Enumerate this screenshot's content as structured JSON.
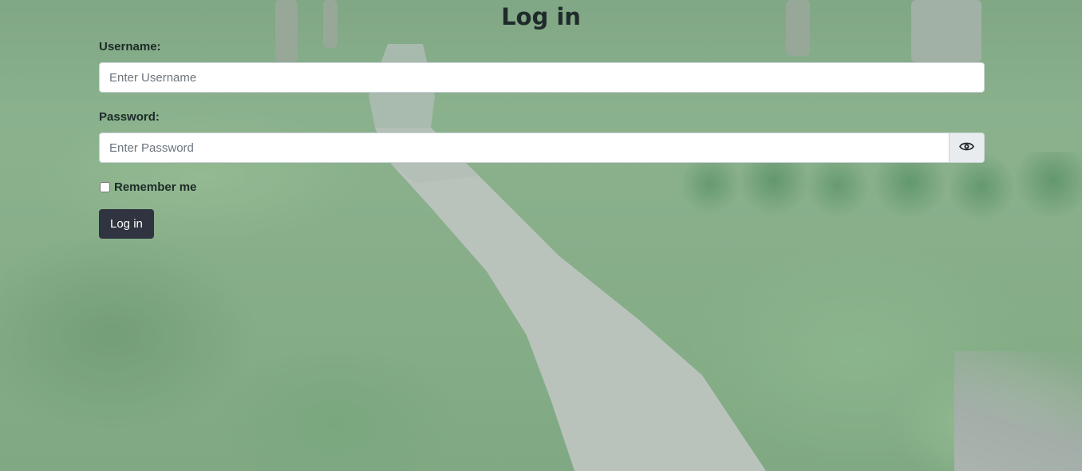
{
  "page": {
    "title": "Log in"
  },
  "form": {
    "username": {
      "label": "Username:",
      "placeholder": "Enter Username",
      "value": ""
    },
    "password": {
      "label": "Password:",
      "placeholder": "Enter Password",
      "value": "",
      "toggle_icon": "eye-icon"
    },
    "remember": {
      "label": "Remember me",
      "checked": false
    },
    "submit_label": "Log in"
  },
  "colors": {
    "button_bg": "#2f3440",
    "button_text": "#ffffff",
    "input_bg": "#ffffff",
    "toggle_bg": "#e9ecef"
  }
}
